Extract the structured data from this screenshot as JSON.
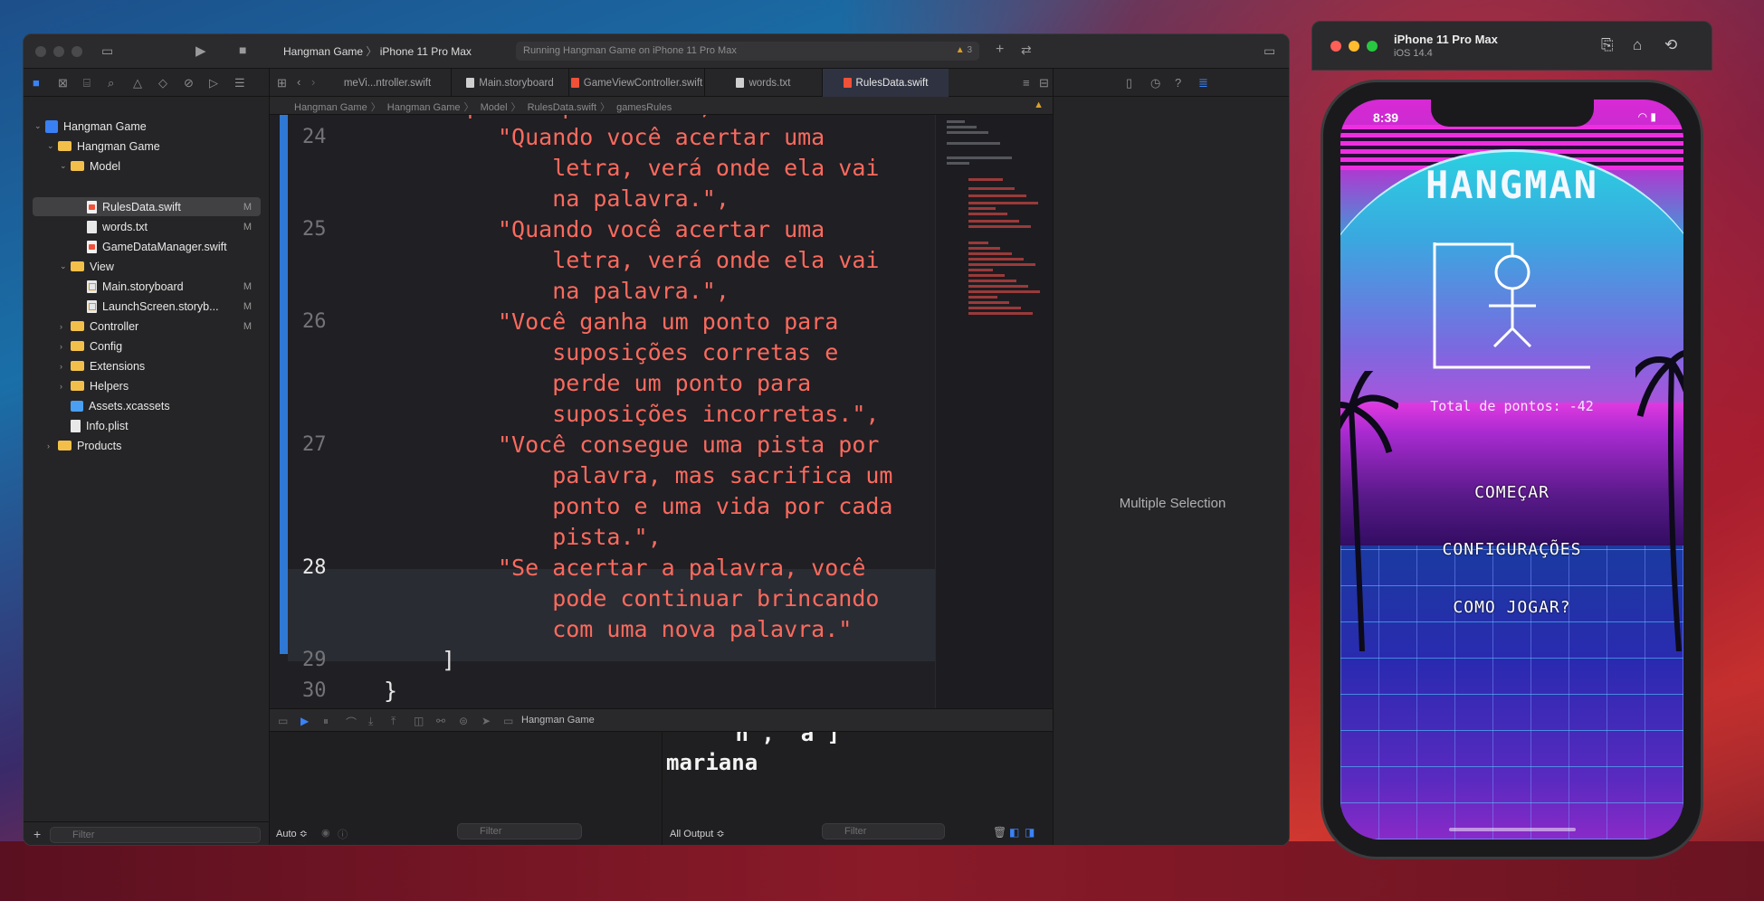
{
  "xcode": {
    "scheme_project": "Hangman Game",
    "scheme_device": "iPhone 11 Pro Max",
    "status": "Running Hangman Game on iPhone 11 Pro Max",
    "warning_count": "3",
    "navigator": {
      "items": [
        {
          "label": "Hangman Game",
          "type": "project",
          "badge": ""
        },
        {
          "label": "Hangman Game",
          "type": "folder",
          "badge": ""
        },
        {
          "label": "Model",
          "type": "folder",
          "badge": ""
        },
        {
          "label": "RulesData.swift",
          "type": "swift",
          "badge": "M"
        },
        {
          "label": "words.txt",
          "type": "txt",
          "badge": "M"
        },
        {
          "label": "GameDataManager.swift",
          "type": "swift",
          "badge": ""
        },
        {
          "label": "View",
          "type": "folder",
          "badge": ""
        },
        {
          "label": "Main.storyboard",
          "type": "storyboard",
          "badge": "M"
        },
        {
          "label": "LaunchScreen.storyb...",
          "type": "storyboard",
          "badge": "M"
        },
        {
          "label": "Controller",
          "type": "folder",
          "badge": "M"
        },
        {
          "label": "Config",
          "type": "folder",
          "badge": ""
        },
        {
          "label": "Extensions",
          "type": "folder",
          "badge": ""
        },
        {
          "label": "Helpers",
          "type": "folder",
          "badge": ""
        },
        {
          "label": "Assets.xcassets",
          "type": "assets",
          "badge": ""
        },
        {
          "label": "Info.plist",
          "type": "txt",
          "badge": ""
        },
        {
          "label": "Products",
          "type": "folder",
          "badge": ""
        }
      ],
      "filter_placeholder": "Filter"
    },
    "tabs": [
      "meVi...ntroller.swift",
      "Main.storyboard",
      "GameViewController.swift",
      "words.txt",
      "RulesData.swift"
    ],
    "jumpbar": [
      "Hangman Game",
      "Hangman Game",
      "Model",
      "RulesData.swift",
      "gamesRules"
    ],
    "code": {
      "partial_top": "pontos possível.\",",
      "lines": [
        {
          "num": "24",
          "text": [
            "\"Quando você acertar uma",
            "    letra, verá onde ela vai",
            "    na palavra.\","
          ]
        },
        {
          "num": "25",
          "text": [
            "\"Quando você acertar uma",
            "    letra, verá onde ela vai",
            "    na palavra.\","
          ]
        },
        {
          "num": "26",
          "text": [
            "\"Você ganha um ponto para",
            "    suposições corretas e",
            "    perde um ponto para",
            "    suposições incorretas.\","
          ]
        },
        {
          "num": "27",
          "text": [
            "\"Você consegue uma pista por",
            "    palavra, mas sacrifica um",
            "    ponto e uma vida por cada",
            "    pista.\","
          ]
        },
        {
          "num": "28",
          "text": [
            "\"Se acertar a palavra, você",
            "    pode continuar brincando",
            "    com uma nova palavra.\""
          ]
        },
        {
          "num": "29",
          "text": [
            "]"
          ]
        },
        {
          "num": "30",
          "text": [
            "}"
          ]
        }
      ]
    },
    "debug": {
      "target": "Hangman Game",
      "console_line1": "\"n\", \"a\"]",
      "console_line2": "mariana",
      "auto_label": "Auto ≎",
      "all_output_label": "All Output ≎",
      "filter_placeholder": "Filter"
    },
    "inspector": {
      "message": "Multiple Selection"
    }
  },
  "simulator": {
    "device_name": "iPhone 11 Pro Max",
    "os": "iOS 14.4",
    "time": "8:39",
    "game": {
      "title": "HANGMAN",
      "score": "Total de pontos: -42",
      "buttons": [
        "COMEÇAR",
        "CONFIGURAÇÕES",
        "COMO JOGAR?"
      ]
    }
  },
  "colors": {
    "string": "#fc6a5d",
    "accent": "#3a82f6",
    "folder": "#f2c04a"
  }
}
